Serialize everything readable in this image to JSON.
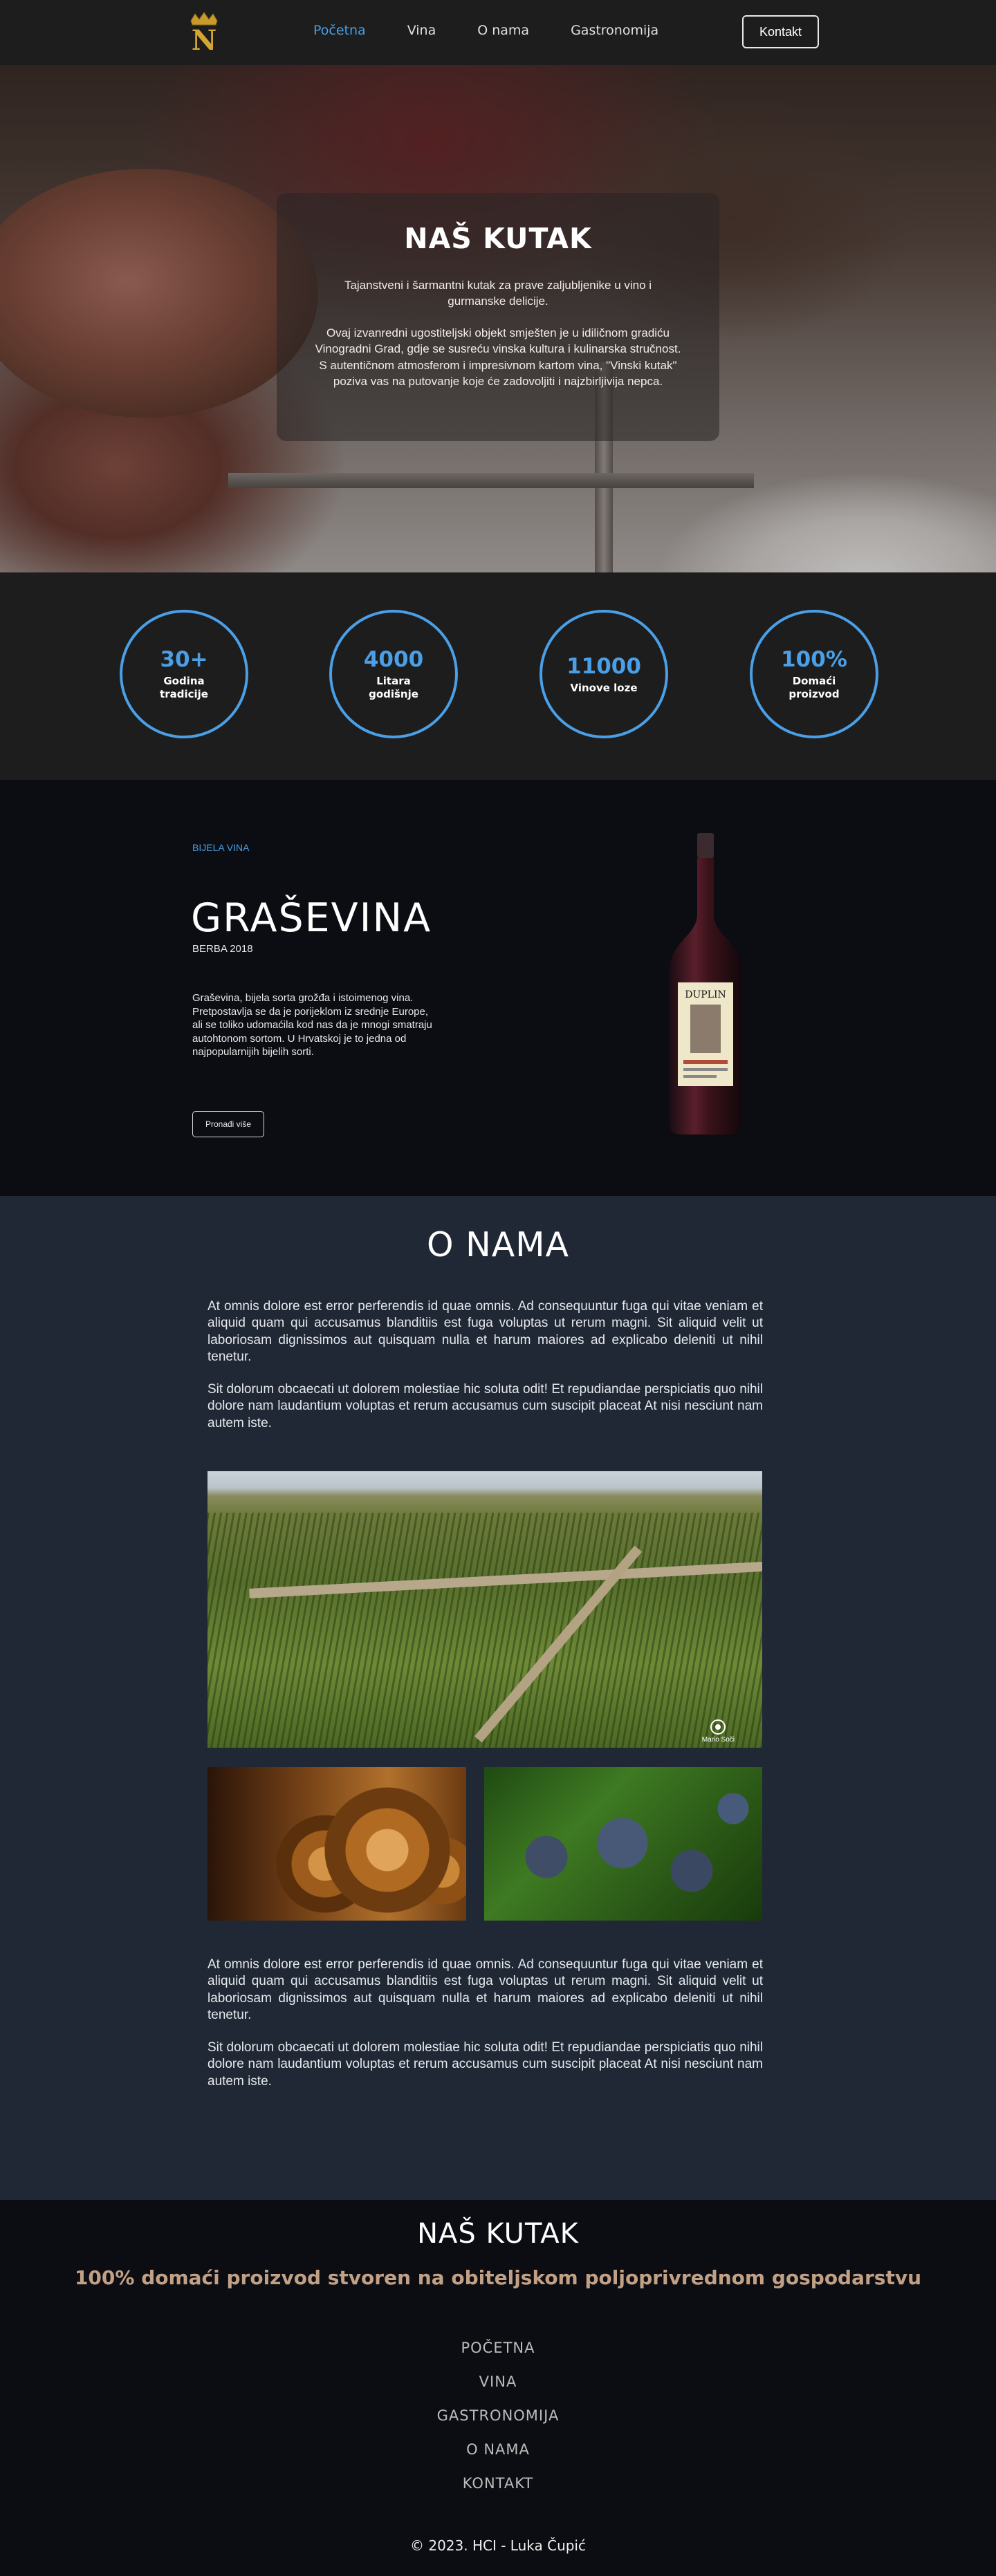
{
  "nav": {
    "logo_letter": "N",
    "links": [
      "Početna",
      "Vina",
      "O nama",
      "Gastronomija"
    ],
    "active_index": 0,
    "contact_label": "Kontakt",
    "accent": "#4a9fe6"
  },
  "hero": {
    "title": "NAŠ KUTAK",
    "lead": "Tajanstveni i šarmantni kutak za prave zaljubljenike u vino i gurmanske delicije.",
    "body": "Ovaj izvanredni ugostiteljski objekt smješten je u idiličnom gradiću Vinogradni Grad, gdje se susreću vinska kultura i kulinarska stručnost. S autentičnom atmosferom i impresivnom kartom vina, \"Vinski kutak\" poziva vas na putovanje koje će zadovoljiti i najzbirljivija nepca."
  },
  "stats": [
    {
      "value": "30+",
      "label": "Godina tradicije"
    },
    {
      "value": "4000",
      "label": "Litara godišnje"
    },
    {
      "value": "11000",
      "label": "Vinove loze"
    },
    {
      "value": "100%",
      "label": "Domaći proizvod"
    }
  ],
  "wine": {
    "kicker": "BIJELA VINA",
    "name": "GRAŠEVINA",
    "vintage": "BERBA 2018",
    "description": "Graševina, bijela sorta grožđa i istoimenog vina. Pretpostavlja se da je porijeklom iz srednje Europe, ali se toliko udomaćila kod nas da je mnogi smatraju autohtonom sortom. U Hrvatskoj je to jedna od najpopularnijih bijelih sorti.",
    "button_label": "Pronađi više",
    "bottle_brand": "DUPLIN"
  },
  "about": {
    "title": "O NAMA",
    "paragraphs_top": [
      "At omnis dolore est error perferendis id quae omnis. Ad consequuntur fuga qui vitae veniam et aliquid quam qui accusamus blanditiis est fuga voluptas ut rerum magni. Sit aliquid velit ut laboriosam dignissimos aut quisquam nulla et harum maiores ad explicabo deleniti ut nihil tenetur.",
      "Sit dolorum obcaecati ut dolorem molestiae hic soluta odit! Et repudiandae perspiciatis quo nihil dolore nam laudantium voluptas et rerum accusamus cum suscipit placeat At nisi nesciunt nam autem iste."
    ],
    "photo_credit": "Mario Soči",
    "paragraphs_bottom": [
      "At omnis dolore est error perferendis id quae omnis. Ad consequuntur fuga qui vitae veniam et aliquid quam qui accusamus blanditiis est fuga voluptas ut rerum magni. Sit aliquid velit ut laboriosam dignissimos aut quisquam nulla et harum maiores ad explicabo deleniti ut nihil tenetur.",
      "Sit dolorum obcaecati ut dolorem molestiae hic soluta odit! Et repudiandae perspiciatis quo nihil dolore nam laudantium voluptas et rerum accusamus cum suscipit placeat At nisi nesciunt nam autem iste."
    ]
  },
  "footer": {
    "title": "NAŠ KUTAK",
    "tagline": "100% domaći proizvod stvoren na obiteljskom poljoprivrednom gospodarstvu",
    "links": [
      "POČETNA",
      "VINA",
      "GASTRONOMIJA",
      "O NAMA",
      "KONTAKT"
    ],
    "copyright": "© 2023. HCI - Luka Čupić",
    "tagline_color": "#c2a085"
  }
}
